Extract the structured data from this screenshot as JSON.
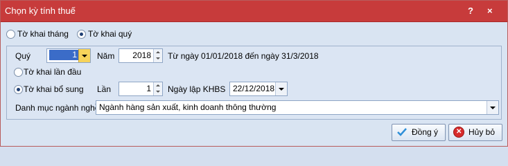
{
  "window": {
    "title": "Chọn kỳ tính thuế",
    "help_glyph": "?",
    "close_glyph": "×"
  },
  "period_type": {
    "monthly_label": "Tờ khai tháng",
    "quarterly_label": "Tờ khai quý",
    "selected": "quarterly"
  },
  "period": {
    "quarter_label": "Quý",
    "quarter_value": "1",
    "year_label": "Năm",
    "year_value": "2018",
    "range_text": "Từ ngày 01/01/2018 đến ngày 31/3/2018"
  },
  "declaration": {
    "first_label": "Tờ khai lần đầu",
    "supplement_label": "Tờ khai bổ sung",
    "selected": "supplement",
    "times_label": "Lần",
    "times_value": "1",
    "date_label": "Ngày lập KHBS",
    "date_value": "22/12/2018"
  },
  "industry": {
    "label": "Danh mục ngành nghề",
    "value": "Ngành hàng sản xuất, kinh doanh thông thường"
  },
  "buttons": {
    "ok_label": "Đồng ý",
    "cancel_label": "Hủy bỏ"
  },
  "colors": {
    "titlebar": "#c73b3b",
    "selection": "#3b6cc8",
    "dropdown_accent": "#f7d35a",
    "cancel_icon": "#d72b2b",
    "ok_icon": "#2f8fd8"
  }
}
